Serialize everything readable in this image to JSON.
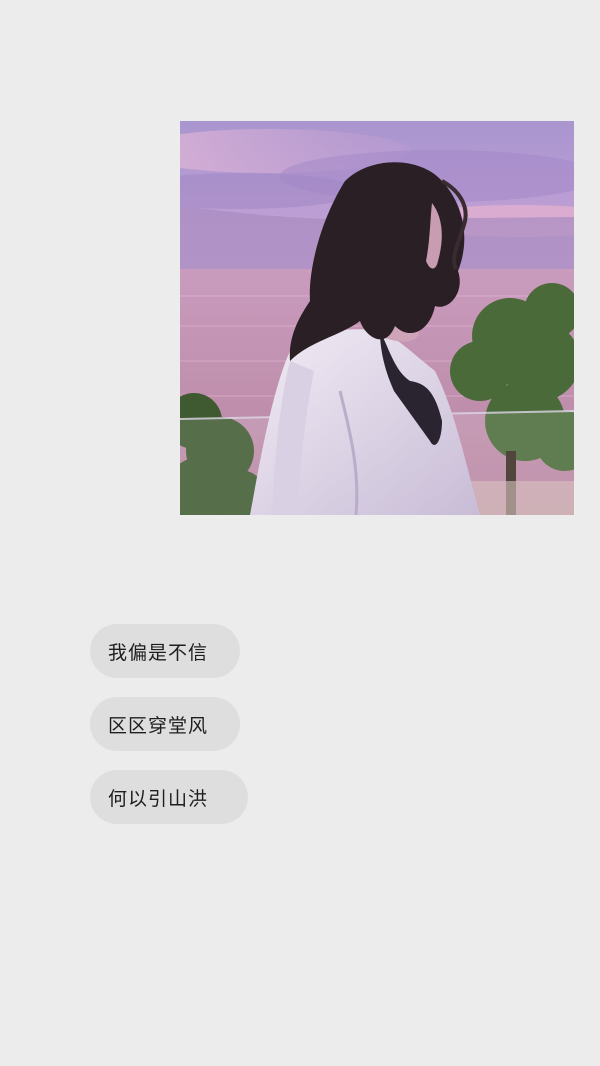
{
  "photo": {
    "subject": "girl-looking-at-sunset-sea-photo",
    "colors": {
      "sky_top": "#b9a7d6",
      "sky_pink": "#e2a9c9",
      "sea": "#c79ab8",
      "hair": "#2a1f24",
      "shirt": "#ebe4f0",
      "foliage": "#4b6a3a"
    }
  },
  "chat": {
    "messages": [
      {
        "text": "我偏是不信"
      },
      {
        "text": "区区穿堂风"
      },
      {
        "text": "何以引山洪"
      }
    ]
  },
  "colors": {
    "background": "#ececec",
    "bubble": "#dedede",
    "text": "#1e1e1e"
  }
}
